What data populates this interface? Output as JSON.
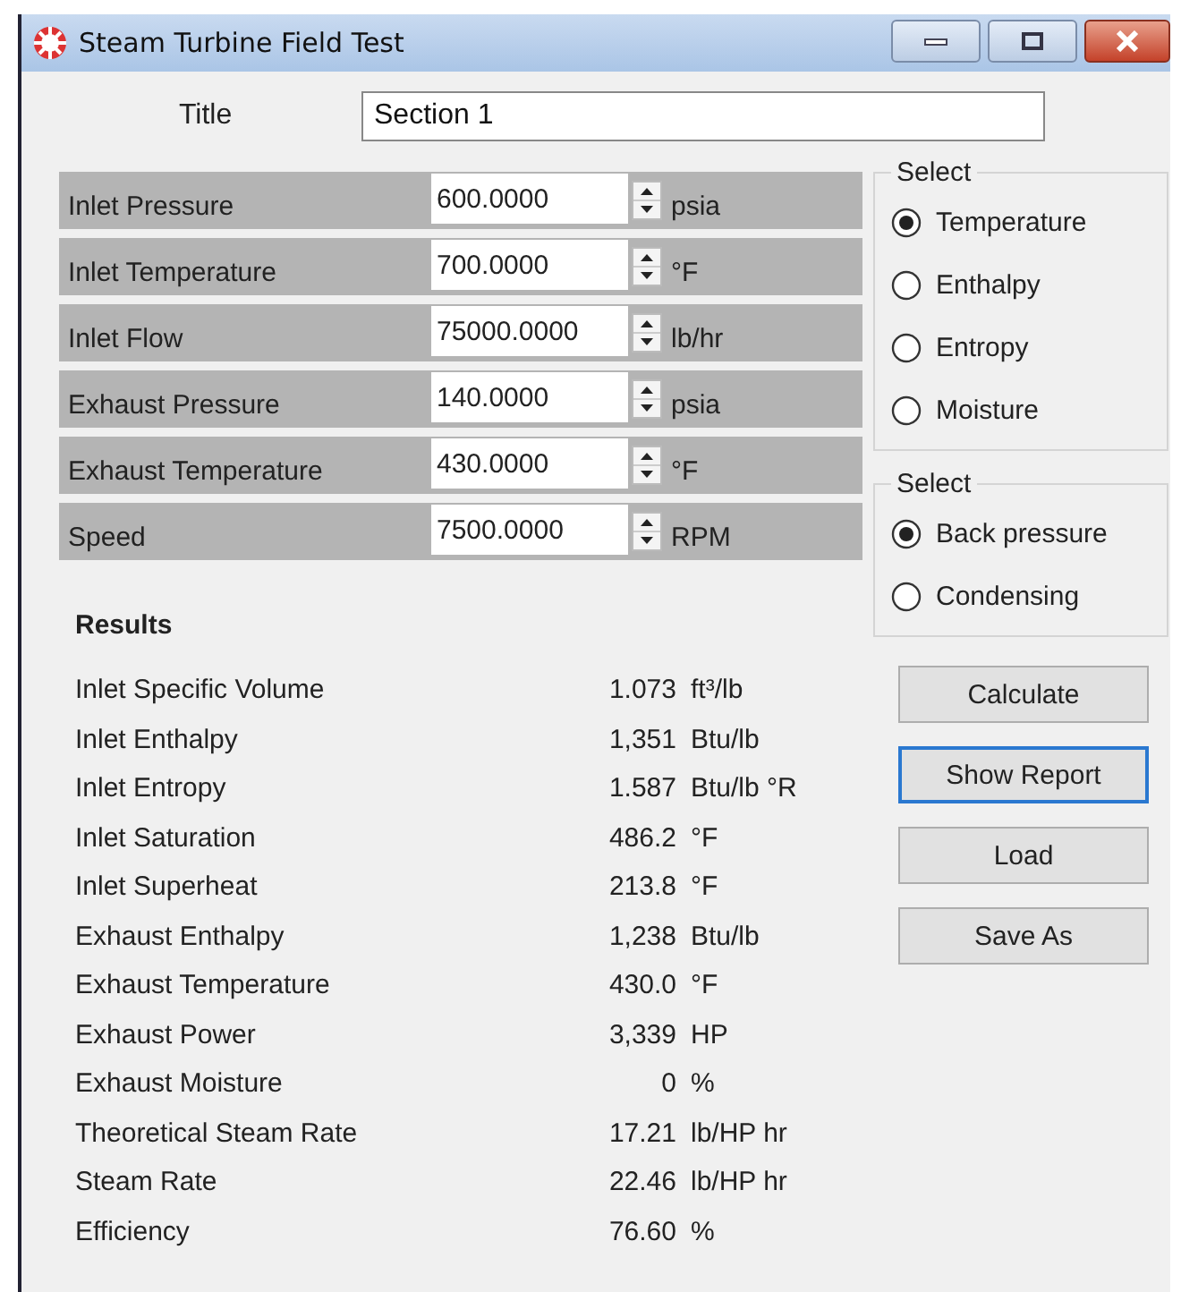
{
  "window": {
    "title": "Steam Turbine Field Test"
  },
  "title_field": {
    "label": "Title",
    "value": "Section 1"
  },
  "inputs": [
    {
      "label": "Inlet Pressure",
      "value": "600.0000",
      "unit": "psia"
    },
    {
      "label": "Inlet Temperature",
      "value": "700.0000",
      "unit": "°F"
    },
    {
      "label": "Inlet Flow",
      "value": "75000.0000",
      "unit": "lb/hr"
    },
    {
      "label": "Exhaust Pressure",
      "value": "140.0000",
      "unit": "psia"
    },
    {
      "label": "Exhaust Temperature",
      "value": "430.0000",
      "unit": "°F"
    },
    {
      "label": "Speed",
      "value": "7500.0000",
      "unit": "RPM"
    }
  ],
  "groups": [
    {
      "title": "Select",
      "options": [
        {
          "label": "Temperature",
          "selected": true
        },
        {
          "label": "Enthalpy",
          "selected": false
        },
        {
          "label": "Entropy",
          "selected": false
        },
        {
          "label": "Moisture",
          "selected": false
        }
      ]
    },
    {
      "title": "Select",
      "options": [
        {
          "label": "Back pressure",
          "selected": true
        },
        {
          "label": "Condensing",
          "selected": false
        }
      ]
    }
  ],
  "results": {
    "title": "Results",
    "rows": [
      {
        "label": "Inlet Specific Volume",
        "value": "1.073",
        "unit": "ft³/lb"
      },
      {
        "label": "Inlet Enthalpy",
        "value": "1,351",
        "unit": "Btu/lb"
      },
      {
        "label": "Inlet Entropy",
        "value": "1.587",
        "unit": "Btu/lb °R"
      },
      {
        "label": "Inlet Saturation",
        "value": "486.2",
        "unit": "°F"
      },
      {
        "label": "Inlet Superheat",
        "value": "213.8",
        "unit": "°F"
      },
      {
        "label": "Exhaust Enthalpy",
        "value": "1,238",
        "unit": "Btu/lb"
      },
      {
        "label": "Exhaust Temperature",
        "value": "430.0",
        "unit": "°F"
      },
      {
        "label": "Exhaust Power",
        "value": "3,339",
        "unit": "HP"
      },
      {
        "label": "Exhaust Moisture",
        "value": "0",
        "unit": "%"
      },
      {
        "label": "Theoretical Steam Rate",
        "value": "17.21",
        "unit": "lb/HP hr"
      },
      {
        "label": "Steam Rate",
        "value": "22.46",
        "unit": "lb/HP hr"
      },
      {
        "label": "Efficiency",
        "value": "76.60",
        "unit": "%"
      }
    ]
  },
  "buttons": [
    {
      "label": "Calculate",
      "focused": false
    },
    {
      "label": "Show Report",
      "focused": true
    },
    {
      "label": "Load",
      "focused": false
    },
    {
      "label": "Save As",
      "focused": false
    }
  ]
}
